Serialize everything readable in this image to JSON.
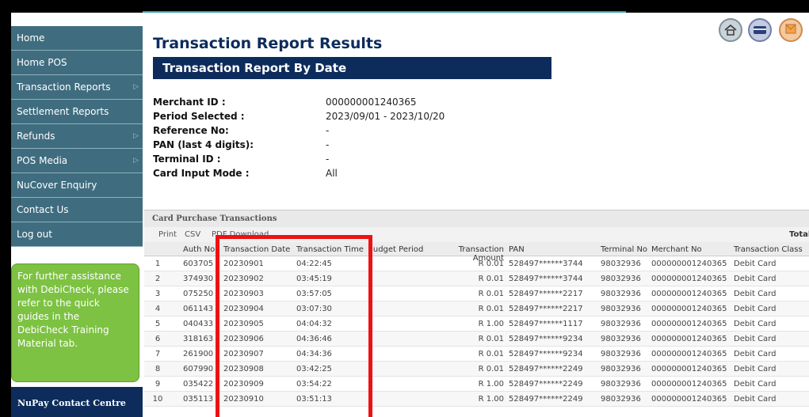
{
  "sidebar": {
    "items": [
      {
        "label": "Home",
        "arrow": ""
      },
      {
        "label": "Home POS",
        "arrow": ""
      },
      {
        "label": "Transaction Reports",
        "arrow": "▷"
      },
      {
        "label": "Settlement Reports",
        "arrow": ""
      },
      {
        "label": "Refunds",
        "arrow": "▷"
      },
      {
        "label": "POS Media",
        "arrow": "▷"
      },
      {
        "label": "NuCover Enquiry",
        "arrow": ""
      },
      {
        "label": "Contact Us",
        "arrow": ""
      },
      {
        "label": "Log out",
        "arrow": ""
      }
    ],
    "help_text": "For further assistance with DebiCheck, please refer to the quick guides in the DebiCheck Training Material tab.",
    "contact_title": "NuPay Contact Centre"
  },
  "header": {
    "title": "Transaction Report Results",
    "subtitle": "Transaction Report By Date",
    "icons": [
      "home-icon",
      "card-icon",
      "mail-icon"
    ]
  },
  "info": {
    "merchant_id_label": "Merchant ID :",
    "merchant_id": "000000001240365",
    "period_label": "Period Selected :",
    "period": "2023/09/01 - 2023/10/20",
    "reference_label": "Reference No:",
    "reference": "-",
    "pan_label": "PAN (last 4 digits):",
    "pan": "-",
    "terminal_label": "Terminal ID :",
    "terminal": "-",
    "card_input_label": "Card Input Mode :",
    "card_input": "All"
  },
  "table": {
    "panel_title": "Card Purchase Transactions",
    "toolbar": {
      "print": "Print",
      "csv": "CSV",
      "pdf": "PDF Download",
      "total": "Total"
    },
    "columns": [
      "Auth No",
      "Transaction Date",
      "Transaction Time",
      "Budget Period",
      "Transaction Amount",
      "PAN",
      "Terminal No",
      "Merchant No",
      "Transaction Class"
    ],
    "rows": [
      {
        "idx": "1",
        "auth": "603705",
        "date": "20230901",
        "time": "04:22:45",
        "budget": "",
        "amount": "R 0.01",
        "pan": "528497******3744",
        "terminal": "98032936",
        "merchant": "000000001240365",
        "class": "Debit Card"
      },
      {
        "idx": "2",
        "auth": "374930",
        "date": "20230902",
        "time": "03:45:19",
        "budget": "",
        "amount": "R 0.01",
        "pan": "528497******3744",
        "terminal": "98032936",
        "merchant": "000000001240365",
        "class": "Debit Card"
      },
      {
        "idx": "3",
        "auth": "075250",
        "date": "20230903",
        "time": "03:57:05",
        "budget": "",
        "amount": "R 0.01",
        "pan": "528497******2217",
        "terminal": "98032936",
        "merchant": "000000001240365",
        "class": "Debit Card"
      },
      {
        "idx": "4",
        "auth": "061143",
        "date": "20230904",
        "time": "03:07:30",
        "budget": "",
        "amount": "R 0.01",
        "pan": "528497******2217",
        "terminal": "98032936",
        "merchant": "000000001240365",
        "class": "Debit Card"
      },
      {
        "idx": "5",
        "auth": "040433",
        "date": "20230905",
        "time": "04:04:32",
        "budget": "",
        "amount": "R 1.00",
        "pan": "528497******1117",
        "terminal": "98032936",
        "merchant": "000000001240365",
        "class": "Debit Card"
      },
      {
        "idx": "6",
        "auth": "318163",
        "date": "20230906",
        "time": "04:36:46",
        "budget": "",
        "amount": "R 0.01",
        "pan": "528497******9234",
        "terminal": "98032936",
        "merchant": "000000001240365",
        "class": "Debit Card"
      },
      {
        "idx": "7",
        "auth": "261900",
        "date": "20230907",
        "time": "04:34:36",
        "budget": "",
        "amount": "R 0.01",
        "pan": "528497******9234",
        "terminal": "98032936",
        "merchant": "000000001240365",
        "class": "Debit Card"
      },
      {
        "idx": "8",
        "auth": "607990",
        "date": "20230908",
        "time": "03:42:25",
        "budget": "",
        "amount": "R 0.01",
        "pan": "528497******2249",
        "terminal": "98032936",
        "merchant": "000000001240365",
        "class": "Debit Card"
      },
      {
        "idx": "9",
        "auth": "035422",
        "date": "20230909",
        "time": "03:54:22",
        "budget": "",
        "amount": "R 1.00",
        "pan": "528497******2249",
        "terminal": "98032936",
        "merchant": "000000001240365",
        "class": "Debit Card"
      },
      {
        "idx": "10",
        "auth": "035113",
        "date": "20230910",
        "time": "03:51:13",
        "budget": "",
        "amount": "R 1.00",
        "pan": "528497******2249",
        "terminal": "98032936",
        "merchant": "000000001240365",
        "class": "Debit Card"
      }
    ]
  },
  "colors": {
    "nav": "#3f6d7f",
    "navy": "#0d2c5c",
    "help_green": "#7dc242",
    "highlight": "#ee1111"
  }
}
